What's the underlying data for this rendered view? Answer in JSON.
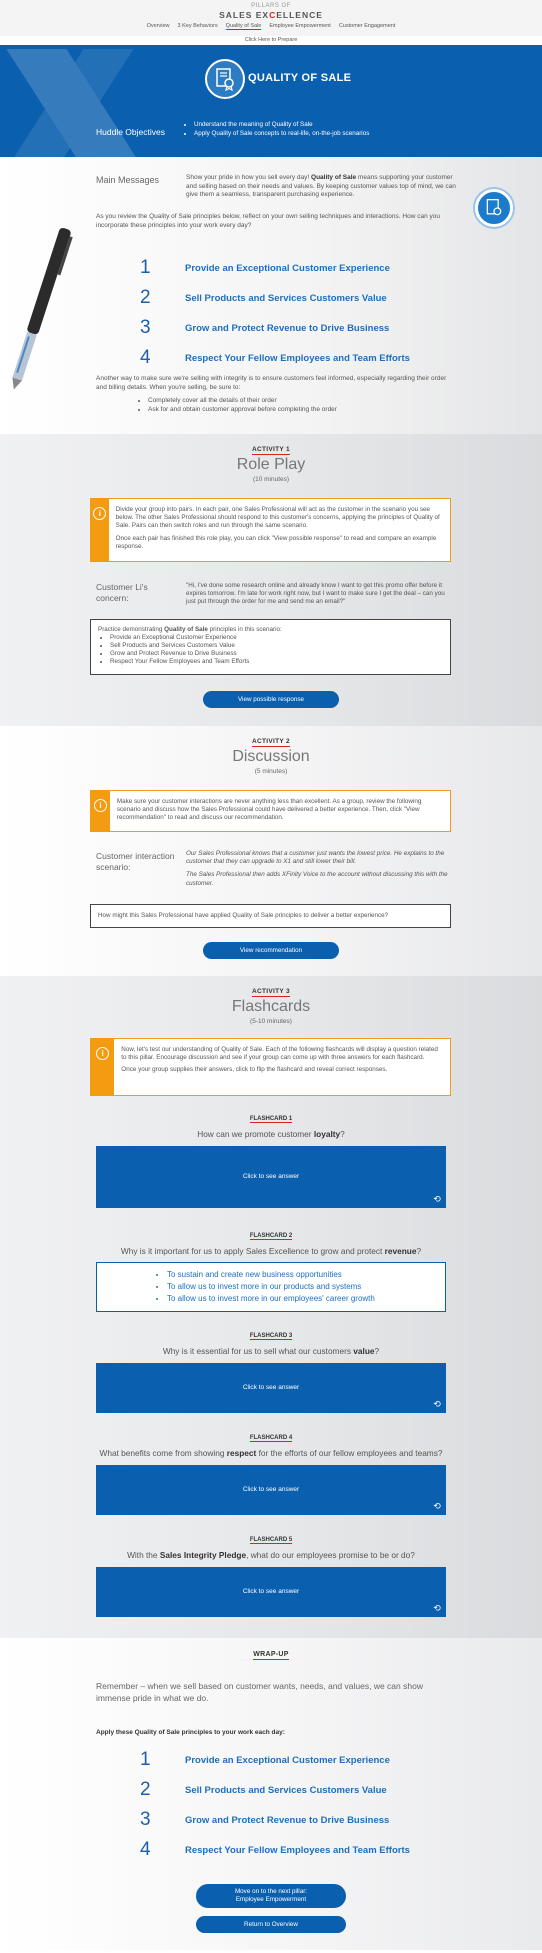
{
  "header": {
    "logo_small": "PILLARS OF",
    "logo_part1": "SALES EX",
    "logo_x": "C",
    "logo_part2": "ELLENCE",
    "nav": [
      "Overview",
      "3 Key Behaviors",
      "Quality of Sale",
      "Employee Empowerment",
      "Customer Engagement"
    ],
    "prepare_link": "Click Here to Prepare"
  },
  "hero": {
    "title": "QUALITY OF SALE",
    "objectives_label": "Huddle Objectives",
    "objectives": [
      "Understand the meaning of Quality of Sale",
      "Apply Quality of Sale concepts to real-life, on-the-job scenarios"
    ]
  },
  "main": {
    "label": "Main Messages",
    "text_pre": "Show your pride in how you sell every day! ",
    "text_bold": "Quality of Sale",
    "text_post": " means supporting your customer and selling based on their needs and values. By keeping customer values top of mind, we can give them a seamless, transparent purchasing experience.",
    "intro": "As you review the Quality of Sale principles below, reflect on your own selling techniques and interactions. How can you incorporate these principles into your work every day?",
    "principles": [
      {
        "num": "1",
        "text": "Provide an Exceptional Customer Experience"
      },
      {
        "num": "2",
        "text": "Sell Products and Services Customers Value"
      },
      {
        "num": "3",
        "text": "Grow and Protect Revenue to Drive Business"
      },
      {
        "num": "4",
        "text": "Respect Your Fellow Employees and Team Efforts"
      }
    ],
    "note": "Another way to make sure we're selling with integrity is to ensure customers feel informed, especially regarding their order and billing details. When you're selling, be sure to:",
    "bullets": [
      "Completely cover all the details of their order",
      "Ask for and obtain customer approval before completing the order"
    ]
  },
  "activity1": {
    "kicker": "ACTIVITY 1",
    "title": "Role Play",
    "duration": "(10 minutes)",
    "notice_p1": "Divide your group into pairs. In each pair, one Sales Professional will act as the customer in the scenario you see below. The other Sales Professional should respond to this customer's concerns, applying the principles of Quality of Sale. Pairs can then switch roles and run through the same scenario.",
    "notice_p2": "Once each pair has finished this role play, you can click \"View possible response\" to read and compare an example response.",
    "customer_label": "Customer Li's concern:",
    "customer_text": "\"Hi, I've done some research online and already know I want to get this promo offer before it expires tomorrow. I'm late for work right now, but I want to make sure I get the deal – can you just put through the order for me and send me an email?\"",
    "practice_pre": "Practice demonstrating ",
    "practice_bold": "Quality of Sale",
    "practice_post": " principles in this scenario:",
    "practice_items": [
      "Provide an Exceptional Customer Experience",
      "Sell Products and Services Customers Value",
      "Grow and Protect Revenue to Drive Business",
      "Respect Your Fellow Employees and Team Efforts"
    ],
    "button": "View possible response"
  },
  "activity2": {
    "kicker": "ACTIVITY 2",
    "title": "Discussion",
    "duration": "(5 minutes)",
    "notice": "Make sure your customer interactions are never anything less than excellent. As a group, review the following scenario and discuss how the Sales Professional could have delivered a better experience. Then, click \"View recommendation\" to read and discuss our recommendation.",
    "scenario_label": "Customer interaction scenario:",
    "scenario_p1": "Our Sales Professional knows that a customer just wants the lowest price. He explains to the customer that they can upgrade to X1 and still lower their bill.",
    "scenario_p2": "The Sales Professional then adds XFinity Voice to the account without discussing this with the customer.",
    "question": "How might this Sales Professional have applied Quality of Sale principles to deliver a better experience?",
    "button": "View recommendation"
  },
  "activity3": {
    "kicker": "ACTIVITY 3",
    "title": "Flashcards",
    "duration": "(5-10 minutes)",
    "notice_p1": "Now, let's test our understanding of Quality of Sale. Each of the following flashcards will display a question related to this pillar. Encourage discussion and see if your group can come up with three answers for each flashcard.",
    "notice_p2": "Once your group supplies their answers, click to flip the flashcard and reveal correct responses.",
    "card_label": "Click to see answer",
    "flashcards": [
      {
        "kicker": "FLASHCARD 1",
        "q_pre": "How can we promote customer ",
        "q_bold": "loyalty",
        "q_post": "?"
      },
      {
        "kicker": "FLASHCARD 2",
        "q_pre": "Why is it important for us to apply Sales Excellence to grow and protect ",
        "q_bold": "revenue",
        "q_post": "?",
        "answers": [
          "To sustain and create new business opportunities",
          "To allow us to invest more in our products and systems",
          "To allow us to invest more in our employees' career growth"
        ]
      },
      {
        "kicker": "FLASHCARD 3",
        "q_pre": "Why is it essential for us to sell what our customers ",
        "q_bold": "value",
        "q_post": "?"
      },
      {
        "kicker": "FLASHCARD 4",
        "q_pre": "What benefits come from showing ",
        "q_bold": "respect",
        "q_post": " for the efforts of our fellow employees and teams?"
      },
      {
        "kicker": "FLASHCARD 5",
        "q_pre": "With the ",
        "q_bold": "Sales Integrity Pledge",
        "q_post": ", what do our employees promise to be or do?"
      }
    ]
  },
  "wrapup": {
    "kicker": "WRAP-UP",
    "text": "Remember – when we sell based on customer wants, needs, and values, we can show immense pride in what we do.",
    "apply": "Apply these Quality of Sale principles to your work each day:",
    "principles": [
      {
        "num": "1",
        "text": "Provide an Exceptional Customer Experience"
      },
      {
        "num": "2",
        "text": "Sell Products and Services Customers Value"
      },
      {
        "num": "3",
        "text": "Grow and Protect Revenue to Drive Business"
      },
      {
        "num": "4",
        "text": "Respect Your Fellow Employees and Team Efforts"
      }
    ],
    "next_line1": "Move on to the next pillar:",
    "next_line2": "Employee Empowerment",
    "return": "Return to Overview"
  },
  "colors": {
    "brand_blue": "#0a5fae",
    "accent_orange": "#f39c12",
    "accent_red": "#dd2222"
  }
}
